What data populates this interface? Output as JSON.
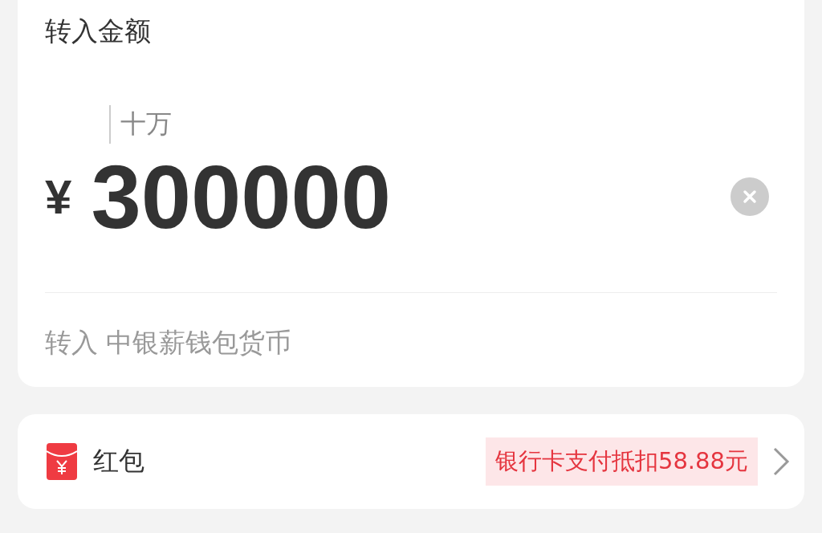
{
  "section_title": "转入金额",
  "amount_field": {
    "unit_hint": "十万",
    "currency": "¥",
    "value": "300000"
  },
  "destination": "转入 中银薪钱包货币",
  "red_packet": {
    "label": "红包",
    "discount": "银行卡支付抵扣58.88元"
  }
}
